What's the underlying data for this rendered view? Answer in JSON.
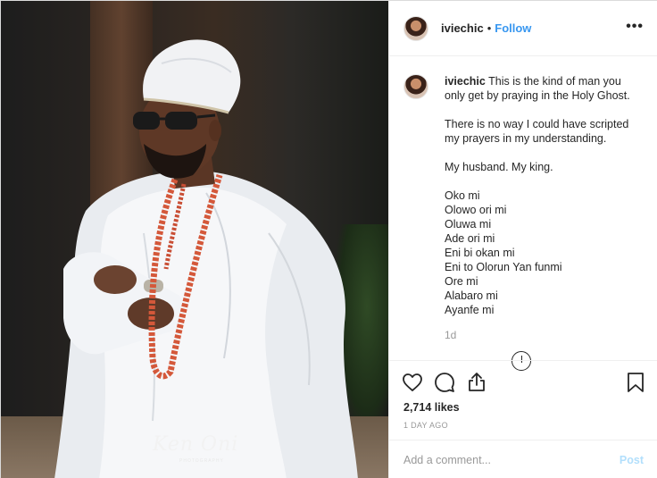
{
  "post": {
    "username": "iviechic",
    "separator": "•",
    "follow_label": "Follow",
    "more_label": "•••",
    "watermark": "Ken Oni",
    "watermark_sub": "PHOTOGRAPHY"
  },
  "caption": {
    "username": "iviechic",
    "first": "This is the kind of man you only get by praying in the Holy Ghost.",
    "para2": "There is no way I could have scripted my prayers in my understanding.",
    "para3": "My husband. My king.",
    "lines": [
      "Oko mi",
      "Olowo ori mi",
      "Oluwa mi",
      "Ade ori mi",
      "Eni bi okan mi",
      "Eni to Olorun Yan funmi",
      "Ore mi",
      "Alabaro mi",
      "Ayanfe mi"
    ],
    "time": "1d"
  },
  "actions": {
    "icons": [
      "heart-icon",
      "comment-icon",
      "share-icon",
      "bookmark-icon"
    ],
    "likes": "2,714 likes",
    "timestamp": "1 DAY AGO"
  },
  "comment_box": {
    "placeholder": "Add a comment...",
    "post_label": "Post"
  },
  "colors": {
    "link": "#3897f0",
    "post_disabled": "#b2dffc",
    "muted": "#999999",
    "text": "#262626"
  }
}
